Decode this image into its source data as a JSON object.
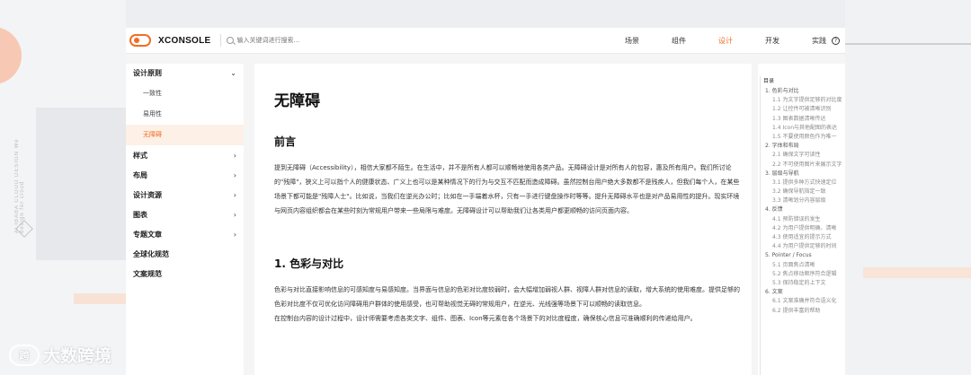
{
  "header": {
    "brand": "XCONSOLE",
    "search_placeholder": "输入关键词进行搜索...",
    "nav": [
      {
        "label": "场景",
        "active": false
      },
      {
        "label": "组件",
        "active": false
      },
      {
        "label": "设计",
        "active": true
      },
      {
        "label": "开发",
        "active": false
      },
      {
        "label": "实践",
        "active": false
      }
    ],
    "help_glyph": "?"
  },
  "sidebar": {
    "design_principles": {
      "label": "设计原则",
      "children": [
        "一致性",
        "易用性",
        "无障碍"
      ],
      "active_child": "无障碍"
    },
    "items": [
      "样式",
      "布局",
      "设计资源",
      "图表",
      "专题文章"
    ],
    "plain_items": [
      "全球化规范",
      "文案规范"
    ]
  },
  "content": {
    "title": "无障碍",
    "intro_heading": "前言",
    "intro_text": "提到无障碍（Accessibility），相信大家都不陌生。在生活中，并不是所有人都可以顺畅地使用各类产品。无障碍设计是对所有人的包容，惠及所有用户。我们所讨论的\"残障\"，狭义上可以指个人的健康状态、广义上也可以是某种情况下的行为与交互不匹配而造成障碍。虽然控制台用户绝大多数都不是残疾人，但我们每个人，在某些场景下都可能是\"残障人士\"。比如说，当我们在逆光办公时；比如在一手端着水杯，只有一手进行键盘操作时等等。提升无障碍水平也是对产品易用性的提升。现实环境与网页内容组织都会在某些时刻为常规用户带来一些局限与难度。无障碍设计可以帮助我们让各类用户都更顺畅的访问页面内容。",
    "section1_heading": "1. 色彩与对比",
    "section1_text1": "色彩与对比直接影响信息的可感知度与易感知度。当界面与信息的色彩对比度较弱时，会大幅增加弱视人群、视障人群对信息的读取，增大系统的使用难度。提供足够的色彩对比度不仅可优化访问障碍用户群体的使用感受，也可帮助视觉无碍的常规用户，在逆光、光线强等场景下可以顺畅的读取信息。",
    "section1_text2": "在控制台内容的设计过程中，设计师需要考虑各类文字、组件、图表、Icon等元素在各个场景下的对比度程度，确保核心信息可准确顺利的传递给用户。"
  },
  "toc": {
    "title": "目录",
    "entries": [
      {
        "level": 1,
        "text": "1. 色彩与对比"
      },
      {
        "level": 2,
        "text": "1.1 为文字提供足够的对比度"
      },
      {
        "level": 2,
        "text": "1.2 让控件可被清晰识别"
      },
      {
        "level": 2,
        "text": "1.3 图表数据清晰传达"
      },
      {
        "level": 2,
        "text": "1.4 Icon与其他配图的表达"
      },
      {
        "level": 2,
        "text": "1.5 不要使用颜色作为唯一"
      },
      {
        "level": 1,
        "text": "2. 字体和布局"
      },
      {
        "level": 2,
        "text": "2.1 确保文字可读性"
      },
      {
        "level": 2,
        "text": "2.2 不可使用图片来展示文字"
      },
      {
        "level": 1,
        "text": "3. 层级与导航"
      },
      {
        "level": 2,
        "text": "3.1 提供多种方式快速定位"
      },
      {
        "level": 2,
        "text": "3.2 确保导航指定一致"
      },
      {
        "level": 2,
        "text": "3.3 清晰划分内容层级"
      },
      {
        "level": 1,
        "text": "4. 反馈"
      },
      {
        "level": 2,
        "text": "4.1 预防错误的发生"
      },
      {
        "level": 2,
        "text": "4.2 为用户提供明确、清晰"
      },
      {
        "level": 2,
        "text": "4.3 使用适宜的提示方式"
      },
      {
        "level": 2,
        "text": "4.4 为用户提供足够的时间"
      },
      {
        "level": 1,
        "text": "5. Pointer / Focus"
      },
      {
        "level": 2,
        "text": "5.1 页面焦点清晰"
      },
      {
        "level": 2,
        "text": "5.2 焦点移动顺序符合逻辑"
      },
      {
        "level": 2,
        "text": "5.3 保持稳定的上下文"
      },
      {
        "level": 1,
        "text": "6. 文案"
      },
      {
        "level": 2,
        "text": "6.1 文案准确并符合语义化"
      },
      {
        "level": 2,
        "text": "6.2 提供丰富的帮助"
      }
    ]
  },
  "background": {
    "vertical_brand": "ALIBABA CLOUD DESIGN",
    "vertical_sub": "We design for cloud",
    "watermark": "大数跨境",
    "watermark_icon": "跨"
  },
  "colors": {
    "accent": "#f26d21",
    "active_bg": "#fdf0e7",
    "page_bg": "#f5f5f5"
  }
}
